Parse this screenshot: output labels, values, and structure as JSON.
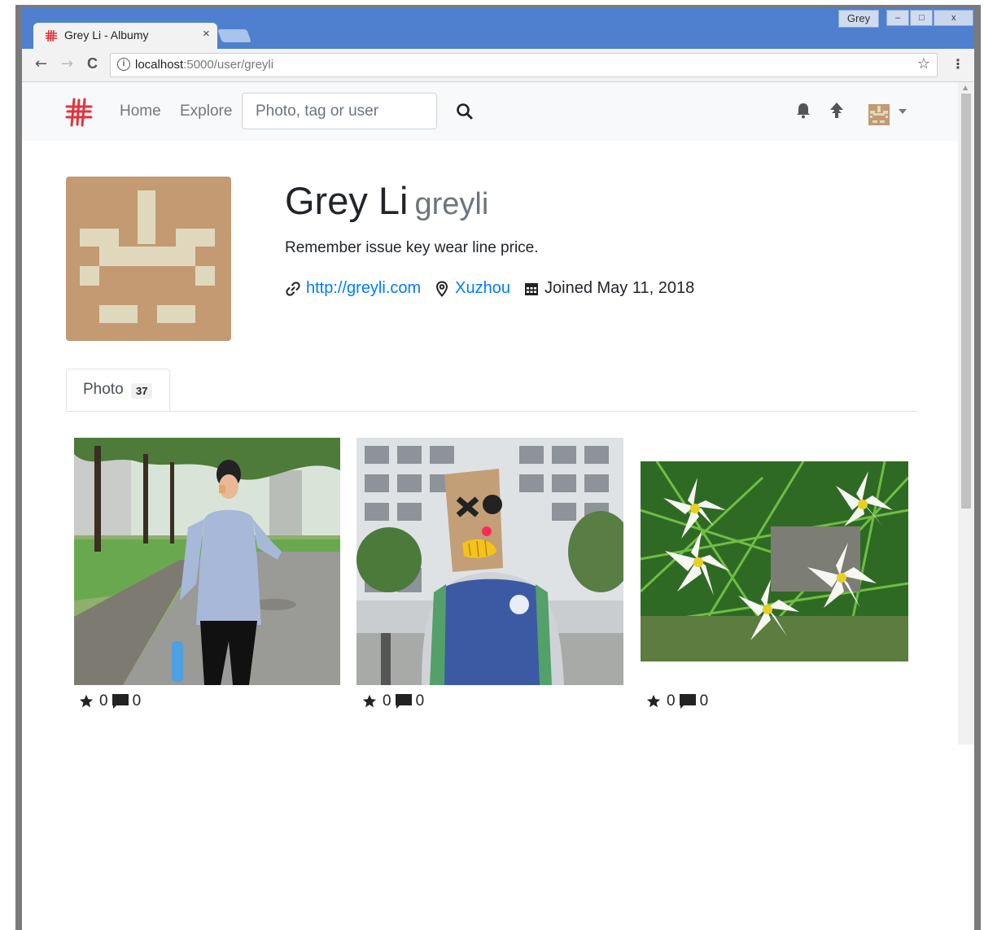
{
  "browser": {
    "tab_title": "Grey Li - Albumy",
    "tab_close": "×",
    "user_chip": "Grey",
    "window_buttons": {
      "minimize": "–",
      "maximize": "□",
      "close": "x"
    },
    "url_host": "localhost",
    "url_path": ":5000/user/greyli",
    "back_glyph": "←",
    "forward_glyph": "→",
    "reload_glyph": "C",
    "info_glyph": "i",
    "bookmark_glyph": "☆",
    "menu_glyph": "⋮"
  },
  "navbar": {
    "home_label": "Home",
    "explore_label": "Explore",
    "search_placeholder": "Photo, tag or user"
  },
  "profile": {
    "name": "Grey Li",
    "username": "greyli",
    "bio": "Remember issue key wear line price.",
    "website": "http://greyli.com",
    "location": "Xuzhou",
    "joined": "Joined May 11, 2018"
  },
  "tabs": {
    "photo_label": "Photo",
    "photo_count": "37"
  },
  "photos": [
    {
      "stars": "0",
      "comments": "0",
      "description": "woman on tree-lined road"
    },
    {
      "stars": "0",
      "comments": "0",
      "description": "person with cardboard box mask"
    },
    {
      "stars": "0",
      "comments": "0",
      "description": "white lily flowers"
    }
  ],
  "colors": {
    "titlebar": "#4f80d0",
    "link": "#007bff",
    "avatar_bg": "#c39a72",
    "avatar_fg": "#e0d8bc",
    "logo": "#e0333e"
  }
}
